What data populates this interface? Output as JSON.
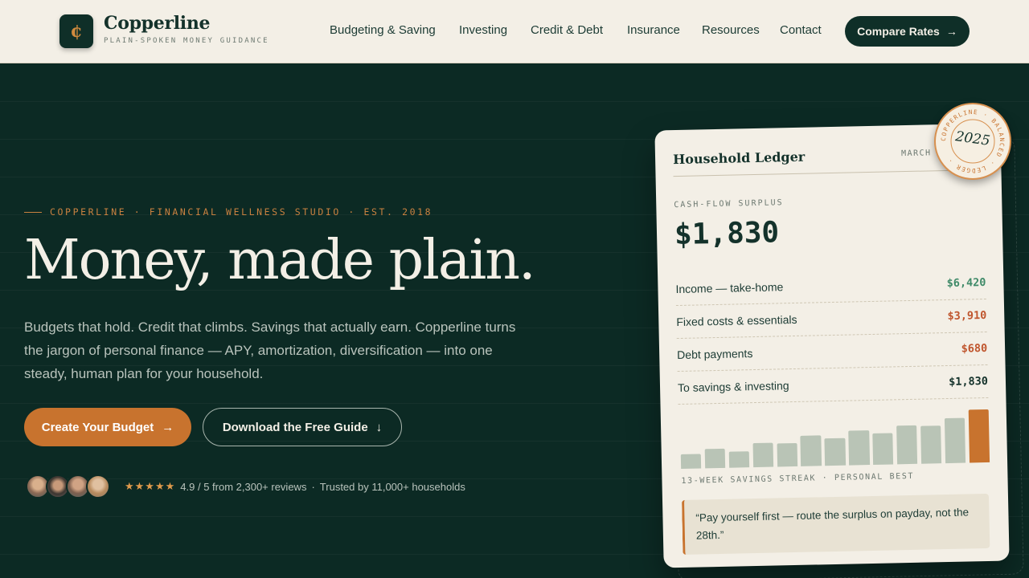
{
  "brand": {
    "mark": "¢",
    "name": "Copperline",
    "tagline": "PLAIN-SPOKEN MONEY GUIDANCE"
  },
  "nav": {
    "items": [
      {
        "label": "Budgeting & Saving"
      },
      {
        "label": "Investing"
      },
      {
        "label": "Credit & Debt"
      },
      {
        "label": "Insurance"
      },
      {
        "label": "Resources"
      },
      {
        "label": "Contact"
      }
    ],
    "cta_label": "Compare Rates",
    "cta_icon": "→"
  },
  "hero": {
    "eyebrow": "COPPERLINE · FINANCIAL WELLNESS STUDIO · EST. 2018",
    "headline": "Money, made plain.",
    "lede": "Budgets that hold. Credit that climbs. Savings that actually earn. Copperline turns the jargon of personal finance — APY, amortization, diversification — into one steady, human plan for your household.",
    "primary_cta": "Create Your Budget",
    "primary_icon": "→",
    "secondary_cta": "Download the Free Guide",
    "secondary_icon": "↓",
    "stars": "★★★★★",
    "rating": "4.9 / 5 from 2,300+ reviews",
    "separator": "·",
    "trust": "Trusted by 11,000+ households"
  },
  "card": {
    "title": "Household Ledger",
    "month": "MARCH",
    "surplus_label": "CASH-FLOW SURPLUS",
    "surplus_value": "$1,830",
    "rows": [
      {
        "label": "Income — take-home",
        "value": "$6,420",
        "color": "#3f8a68"
      },
      {
        "label": "Fixed costs & essentials",
        "value": "$3,910",
        "color": "#c0562e"
      },
      {
        "label": "Debt payments",
        "value": "$680",
        "color": "#c0562e"
      },
      {
        "label": "To savings & investing",
        "value": "$1,830",
        "color": "#14322b"
      }
    ],
    "streak_values": [
      0.27,
      0.36,
      0.31,
      0.46,
      0.44,
      0.58,
      0.52,
      0.65,
      0.59,
      0.73,
      0.71,
      0.85,
      1.0
    ],
    "chart_caption": "13-WEEK SAVINGS STREAK · PERSONAL BEST",
    "quote": "“Pay yourself first — route the surplus on payday, not the 28th.”"
  },
  "seal": {
    "year": "2025",
    "ring_text": "COPPERLINE · BALANCED · LEDGER ·"
  },
  "colors": {
    "accent": "#c8732e",
    "background": "#0c2a24",
    "paper": "#f3efe6"
  }
}
